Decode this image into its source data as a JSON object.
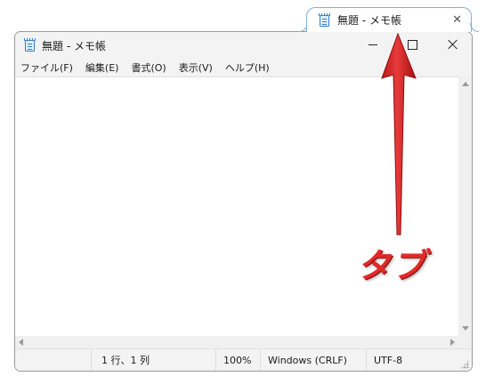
{
  "tab": {
    "title": "無題 - メモ帳",
    "close_glyph": "✕",
    "icon": "notepad-icon"
  },
  "window": {
    "title": "無題 - メモ帳",
    "icon": "notepad-icon",
    "controls": [
      "minimize-icon",
      "maximize-icon",
      "close-icon"
    ]
  },
  "menu": [
    {
      "label": "ファイル(F)"
    },
    {
      "label": "編集(E)"
    },
    {
      "label": "書式(O)"
    },
    {
      "label": "表示(V)"
    },
    {
      "label": "ヘルプ(H)"
    }
  ],
  "statusbar": {
    "position": "1 行、1 列",
    "zoom": "100%",
    "line_ending": "Windows (CRLF)",
    "encoding": "UTF-8"
  },
  "annotation": {
    "label": "タブ",
    "color": "#e02a2a"
  }
}
